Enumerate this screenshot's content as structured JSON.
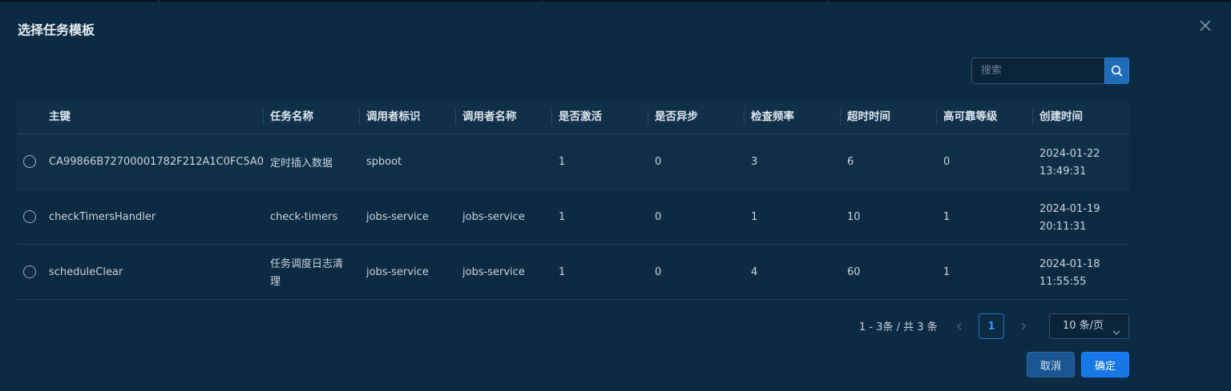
{
  "dialog": {
    "title": "选择任务模板"
  },
  "search": {
    "placeholder": "搜索"
  },
  "table": {
    "columns": [
      "主键",
      "任务名称",
      "调用者标识",
      "调用者名称",
      "是否激活",
      "是否异步",
      "检查频率",
      "超时时间",
      "高可靠等级",
      "创建时间"
    ],
    "rows": [
      {
        "id": "CA99866B72700001782F212A1C0FC5A0",
        "name": "定时插入数据",
        "caller_id": "spboot",
        "caller_name": "",
        "active": "1",
        "async": "0",
        "freq": "3",
        "timeout": "6",
        "ha": "0",
        "created_date": "2024-01-22",
        "created_time": "13:49:31"
      },
      {
        "id": "checkTimersHandler",
        "name": "check-timers",
        "caller_id": "jobs-service",
        "caller_name": "jobs-service",
        "active": "1",
        "async": "0",
        "freq": "1",
        "timeout": "10",
        "ha": "1",
        "created_date": "2024-01-19",
        "created_time": "20:11:31"
      },
      {
        "id": "scheduleClear",
        "name_line1": "任务调度日志清",
        "name_line2": "理",
        "caller_id": "jobs-service",
        "caller_name": "jobs-service",
        "active": "1",
        "async": "0",
        "freq": "4",
        "timeout": "60",
        "ha": "1",
        "created_date": "2024-01-18",
        "created_time": "11:55:55"
      }
    ]
  },
  "pagination": {
    "total_text": "1 - 3条 / 共 3 条",
    "current_page": "1",
    "page_size": "10 条/页"
  },
  "footer": {
    "cancel_label": "取消",
    "ok_label": "确定"
  },
  "colors": {
    "background": "#0b2a43",
    "primary": "#1677e6",
    "header_bg": "#0f3049"
  }
}
